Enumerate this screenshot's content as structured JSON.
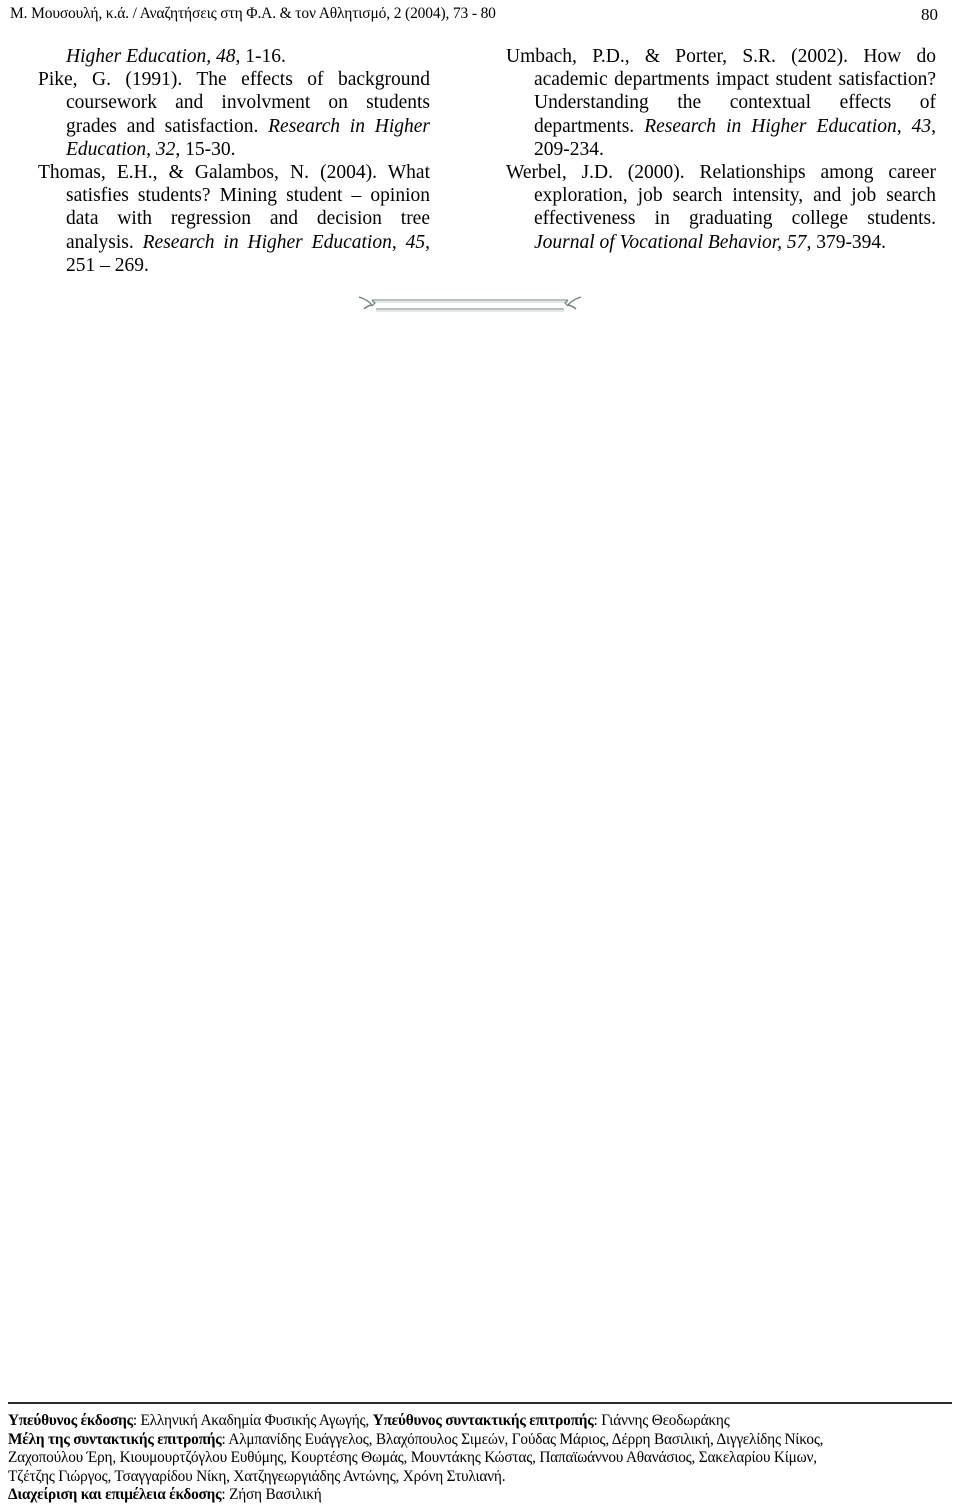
{
  "page": {
    "running_head": "Μ. Μουσουλή, κ.ά. / Αναζητήσεις στη Φ.Α. & τον Αθλητισμό, 2 (2004), 73 - 80",
    "folio": "80"
  },
  "references": {
    "left_column": [
      {
        "id": "ref-continued-lincoln",
        "continued": true,
        "parts": [
          {
            "text": "Higher Education, 48",
            "style": "italic"
          },
          {
            "text": ", 1-16.",
            "style": "normal"
          }
        ]
      },
      {
        "id": "ref-pike-1991",
        "continued": false,
        "parts": [
          {
            "text": "Pike, G. (1991). The effects of background coursework and involvment on students grades and satisfaction. ",
            "style": "normal"
          },
          {
            "text": "Research in Higher Education, 32",
            "style": "italic"
          },
          {
            "text": ", 15-30.",
            "style": "normal"
          }
        ]
      },
      {
        "id": "ref-thomas-galambos-2004",
        "continued": false,
        "parts": [
          {
            "text": "Thomas, E.H., & Galambos, N. (2004). What satisfies students? Mining student – opinion data with regression and decision tree analysis. ",
            "style": "normal"
          },
          {
            "text": "Research in Higher Education, 45",
            "style": "italic"
          },
          {
            "text": ", 251 – 269.",
            "style": "normal"
          }
        ]
      }
    ],
    "right_column": [
      {
        "id": "ref-umbach-porter-2002",
        "continued": false,
        "parts": [
          {
            "text": "Umbach, P.D., & Porter, S.R. (2002). How do academic departments impact student satisfaction? Understanding the contextual effects of departments. ",
            "style": "normal"
          },
          {
            "text": "Research in Higher Education, 43",
            "style": "italic"
          },
          {
            "text": ", 209-234.",
            "style": "normal"
          }
        ]
      },
      {
        "id": "ref-werbel-2000",
        "continued": false,
        "parts": [
          {
            "text": "Werbel, J.D. (2000). Relationships among career exploration, job search intensity, and job search effectiveness in graduating college students. ",
            "style": "normal"
          },
          {
            "text": "Journal of Vocational Behavior, 57",
            "style": "italic"
          },
          {
            "text": ", 379-394.",
            "style": "normal"
          }
        ]
      }
    ]
  },
  "ornament": {
    "name": "double-rule-flourish-ornament",
    "color": "#6b7d78"
  },
  "colophon": {
    "lines": [
      [
        {
          "text": "Υπεύθυνος έκδοσης",
          "style": "bold"
        },
        {
          "text": ": Ελληνική Ακαδημία Φυσικής Αγωγής, ",
          "style": "normal"
        },
        {
          "text": "Υπεύθυνος συντακτικής επιτροπής",
          "style": "bold"
        },
        {
          "text": ": Γιάννης Θεοδωράκης",
          "style": "normal"
        }
      ],
      [
        {
          "text": "Μέλη της συντακτικής επιτροπής",
          "style": "bold"
        },
        {
          "text": ": Αλμπανίδης Ευάγγελος, Βλαχόπουλος Σιμεών, Γούδας Μάριος, Δέρρη Βασιλική, Διγγελίδης Νίκος,",
          "style": "normal"
        }
      ],
      [
        {
          "text": "Ζαχοπούλου Έρη, Κιουμουρτζόγλου Ευθύμης, Κουρτέσης Θωμάς, Μουντάκης Κώστας, Παπαϊωάννου Αθανάσιος, Σακελαρίου Κίμων,",
          "style": "normal"
        }
      ],
      [
        {
          "text": "Τζέτζης Γιώργος, Τσαγγαρίδου Νίκη, Χατζηγεωργιάδης Αντώνης, Χρόνη Στυλιανή.",
          "style": "normal"
        }
      ],
      [
        {
          "text": "Διαχείριση και επιμέλεια έκδοσης",
          "style": "bold"
        },
        {
          "text": ": Ζήση Βασιλική",
          "style": "normal"
        }
      ]
    ]
  }
}
